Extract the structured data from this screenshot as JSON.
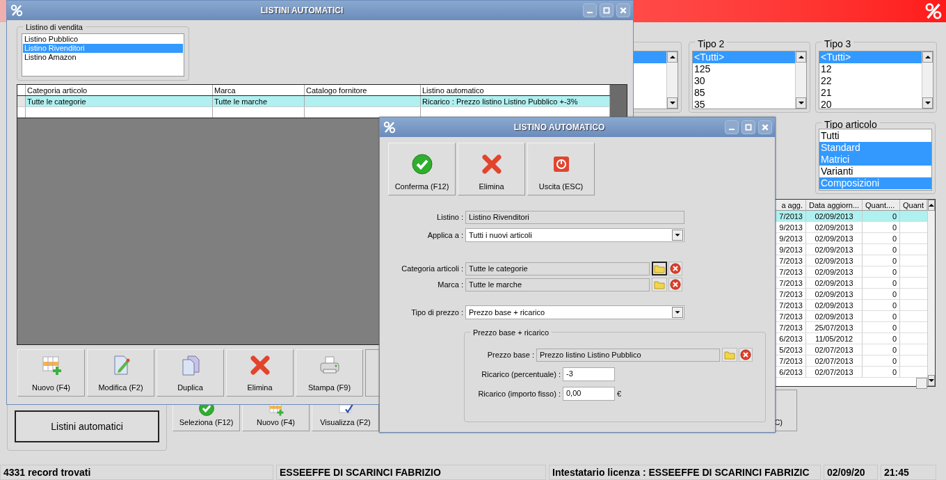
{
  "background": {
    "filters": [
      {
        "title": "Tipo 2",
        "items": [
          {
            "label": "<Tutti>",
            "selected": true
          },
          {
            "label": "125",
            "selected": false
          },
          {
            "label": "30",
            "selected": false
          },
          {
            "label": "85",
            "selected": false
          },
          {
            "label": "35",
            "selected": false
          }
        ]
      },
      {
        "title": "Tipo 3",
        "items": [
          {
            "label": "<Tutti>",
            "selected": true
          },
          {
            "label": "12",
            "selected": false
          },
          {
            "label": "22",
            "selected": false
          },
          {
            "label": "21",
            "selected": false
          },
          {
            "label": "20",
            "selected": false
          }
        ]
      }
    ],
    "tipo_articolo": {
      "title": "Tipo articolo",
      "items": [
        {
          "label": "Tutti",
          "selected": false
        },
        {
          "label": "Standard",
          "selected": true
        },
        {
          "label": "Matrici",
          "selected": true
        },
        {
          "label": "Varianti",
          "selected": false
        },
        {
          "label": "Composizioni",
          "selected": true
        }
      ]
    },
    "grid": {
      "columns": [
        "a agg.",
        "Data aggiorn...",
        "Quant....",
        "Quant"
      ],
      "rows": [
        {
          "cells": [
            "7/2013",
            "02/09/2013",
            "0"
          ],
          "selected": true
        },
        {
          "cells": [
            "9/2013",
            "02/09/2013",
            "0"
          ],
          "selected": false
        },
        {
          "cells": [
            "9/2013",
            "02/09/2013",
            "0"
          ],
          "selected": false
        },
        {
          "cells": [
            "9/2013",
            "02/09/2013",
            "0"
          ],
          "selected": false
        },
        {
          "cells": [
            "7/2013",
            "02/09/2013",
            "0"
          ],
          "selected": false
        },
        {
          "cells": [
            "7/2013",
            "02/09/2013",
            "0"
          ],
          "selected": false
        },
        {
          "cells": [
            "7/2013",
            "02/09/2013",
            "0"
          ],
          "selected": false
        },
        {
          "cells": [
            "7/2013",
            "02/09/2013",
            "0"
          ],
          "selected": false
        },
        {
          "cells": [
            "7/2013",
            "02/09/2013",
            "0"
          ],
          "selected": false
        },
        {
          "cells": [
            "7/2013",
            "02/09/2013",
            "0"
          ],
          "selected": false
        },
        {
          "cells": [
            "7/2013",
            "25/07/2013",
            "0"
          ],
          "selected": false
        },
        {
          "cells": [
            "6/2013",
            "11/05/2012",
            "0"
          ],
          "selected": false
        },
        {
          "cells": [
            "5/2013",
            "02/07/2013",
            "0"
          ],
          "selected": false
        },
        {
          "cells": [
            "7/2013",
            "02/07/2013",
            "0"
          ],
          "selected": false
        },
        {
          "cells": [
            "6/2013",
            "02/07/2013",
            "0"
          ],
          "selected": false
        }
      ]
    },
    "main_button": "Listini automatici",
    "actions": [
      {
        "label": "Seleziona (F12)",
        "kind": "confirm"
      },
      {
        "label": "Nuovo (F4)",
        "kind": "new"
      },
      {
        "label": "Visualizza (F2)",
        "kind": "view"
      }
    ],
    "partial_button": "C)",
    "status_bar": [
      "4331 record trovati",
      "ESSEEFFE DI SCARINCI FABRIZIO",
      "Intestatario licenza : ESSEEFFE DI SCARINCI FABRIZIC",
      "02/09/20",
      "21:45"
    ]
  },
  "listini_window": {
    "title": "LISTINI AUTOMATICI",
    "price_lists": {
      "title": "Listino di vendita",
      "items": [
        {
          "label": "Listino Pubblico",
          "selected": false
        },
        {
          "label": "Listino Rivenditori",
          "selected": true
        },
        {
          "label": "Listino Amazon",
          "selected": false
        }
      ]
    },
    "table": {
      "columns": [
        "Categoria articolo",
        "Marca",
        "Catalogo fornitore",
        "Listino automatico"
      ],
      "rows": [
        {
          "cells": [
            "Tutte le categorie",
            "Tutte le marche",
            "",
            "Ricarico : Prezzo listino Listino Pubblico +-3%"
          ],
          "selected": true
        }
      ]
    },
    "toolbar": [
      {
        "label": "Nuovo (F4)",
        "kind": "new"
      },
      {
        "label": "Modifica (F2)",
        "kind": "edit"
      },
      {
        "label": "Duplica",
        "kind": "duplicate"
      },
      {
        "label": "Elimina",
        "kind": "delete"
      },
      {
        "label": "Stampa (F9)",
        "kind": "print"
      }
    ]
  },
  "listino_window": {
    "title": "LISTINO AUTOMATICO",
    "toolbar": [
      {
        "label": "Conferma (F12)",
        "kind": "confirm"
      },
      {
        "label": "Elimina",
        "kind": "delete"
      },
      {
        "label": "Uscita (ESC)",
        "kind": "exit"
      }
    ],
    "listino": {
      "label": "Listino :",
      "value": "Listino Rivenditori"
    },
    "applica": {
      "label": "Applica a :",
      "value": "Tutti i nuovi articoli"
    },
    "categoria": {
      "label": "Categoria articoli :",
      "value": "Tutte le categorie",
      "focused": true
    },
    "marca": {
      "label": "Marca :",
      "value": "Tutte le marche",
      "focused": false
    },
    "tipo_prezzo": {
      "label": "Tipo di prezzo :",
      "value": "Prezzo base + ricarico"
    },
    "group": {
      "title": "Prezzo base + ricarico",
      "prezzo_base": {
        "label": "Prezzo base :",
        "value": "Prezzo listino Listino Pubblico"
      },
      "ricarico_perc": {
        "label": "Ricarico (percentuale) :",
        "value": "-3"
      },
      "ricarico_fisso": {
        "label": "Ricarico (importo fisso) :",
        "value": "0,00",
        "unit": "€"
      }
    }
  }
}
